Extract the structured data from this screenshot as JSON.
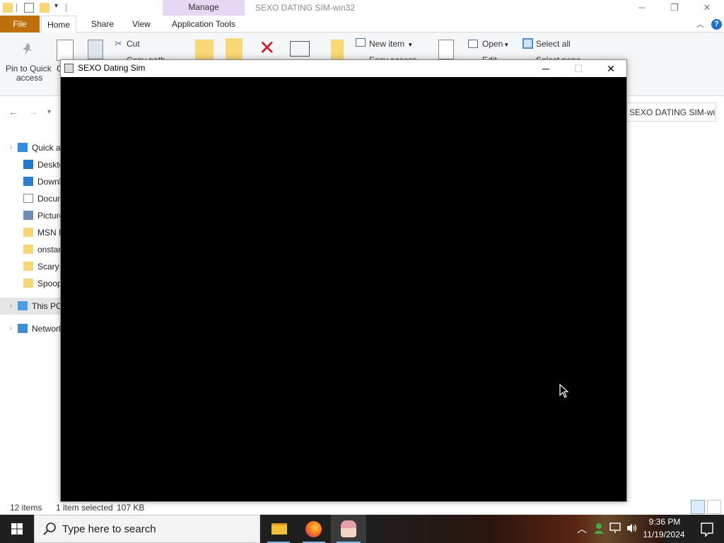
{
  "explorer": {
    "window_title": "SEXO DATING SIM-win32",
    "manage_label": "Manage",
    "tabs": {
      "file": "File",
      "home": "Home",
      "share": "Share",
      "view": "View",
      "app_tools": "Application Tools"
    },
    "ribbon": {
      "pin_to_quick": "Pin to Quick",
      "pin_to_quick_2": "access",
      "copy_partial": "C",
      "cut": "Cut",
      "copy_path": "Copy path",
      "new_item": "New item",
      "easy_access": "Easy access",
      "open": "Open",
      "edit": "Edit",
      "select_all": "Select all",
      "select_none": "Select none"
    },
    "address": "SEXO DATING SIM-wi...",
    "sidebar": [
      {
        "label": "Quick access",
        "icon": "star-icon"
      },
      {
        "label": "Desktop",
        "icon": "desktop-icon"
      },
      {
        "label": "Downloads",
        "icon": "download-icon"
      },
      {
        "label": "Documents",
        "icon": "documents-icon"
      },
      {
        "label": "Pictures",
        "icon": "pictures-icon"
      },
      {
        "label": "MSN M",
        "icon": "folder-icon"
      },
      {
        "label": "onstar",
        "icon": "folder-icon"
      },
      {
        "label": "Scary",
        "icon": "folder-icon"
      },
      {
        "label": "Spoop",
        "icon": "folder-icon"
      },
      {
        "label": "This PC",
        "icon": "pc-icon"
      },
      {
        "label": "Network",
        "icon": "network-icon"
      }
    ],
    "status": {
      "items": "12 items",
      "selected": "1 item selected",
      "size": "107 KB"
    }
  },
  "game": {
    "title": "SEXO Dating Sim"
  },
  "taskbar": {
    "search_placeholder": "Type here to search",
    "time": "9:36 PM",
    "date": "11/19/2024"
  },
  "colors": {
    "file_tab": "#c0700a",
    "manage_tab": "#e6d7f5",
    "taskbar": "#1f1f1f",
    "accent": "#76b9ed"
  }
}
